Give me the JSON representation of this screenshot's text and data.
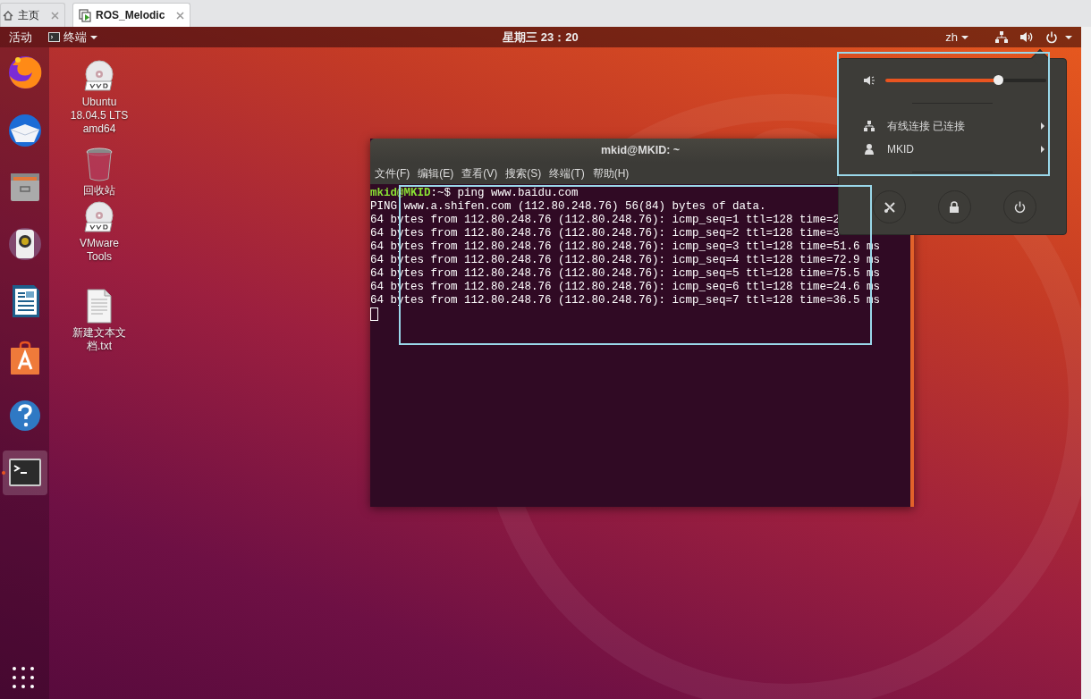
{
  "browser_tabs": [
    {
      "label": "主页",
      "selected": false
    },
    {
      "label": "ROS_Melodic",
      "selected": true
    }
  ],
  "top_bar": {
    "activities": "活动",
    "app_menu": "终端",
    "clock": "星期三 23：20",
    "input_method": "zh"
  },
  "dock": {
    "items": [
      {
        "active": false
      },
      {
        "active": false
      },
      {
        "active": false
      },
      {
        "active": false
      },
      {
        "active": false
      },
      {
        "active": false
      },
      {
        "active": false
      },
      {
        "active": true
      }
    ]
  },
  "desktop_icons": [
    {
      "label": "Ubuntu 18.04.5 LTS amd64"
    },
    {
      "label": "回收站"
    },
    {
      "label": "VMware Tools"
    },
    {
      "label": "新建文本文档.txt"
    }
  ],
  "terminal": {
    "title": "mkid@MKID: ~",
    "menu": [
      "文件(F)",
      "编辑(E)",
      "查看(V)",
      "搜索(S)",
      "终端(T)",
      "帮助(H)"
    ],
    "prompt": "mkid@MKID",
    "cwd": ":~$",
    "command": " ping www.baidu.com",
    "output": [
      "PING www.a.shifen.com (112.80.248.76) 56(84) bytes of data.",
      "64 bytes from 112.80.248.76 (112.80.248.76): icmp_seq=1 ttl=128 time=2",
      "64 bytes from 112.80.248.76 (112.80.248.76): icmp_seq=2 ttl=128 time=3",
      "64 bytes from 112.80.248.76 (112.80.248.76): icmp_seq=3 ttl=128 time=51.6 ms",
      "64 bytes from 112.80.248.76 (112.80.248.76): icmp_seq=4 ttl=128 time=72.9 ms",
      "64 bytes from 112.80.248.76 (112.80.248.76): icmp_seq=5 ttl=128 time=75.5 ms",
      "64 bytes from 112.80.248.76 (112.80.248.76): icmp_seq=6 ttl=128 time=24.6 ms",
      "64 bytes from 112.80.248.76 (112.80.248.76): icmp_seq=7 ttl=128 time=36.5 ms"
    ]
  },
  "system_menu": {
    "volume": {
      "level": 0.7
    },
    "items": [
      {
        "label": "有线连接 已连接",
        "kind": "network"
      },
      {
        "label": "MKID",
        "kind": "user"
      }
    ]
  }
}
